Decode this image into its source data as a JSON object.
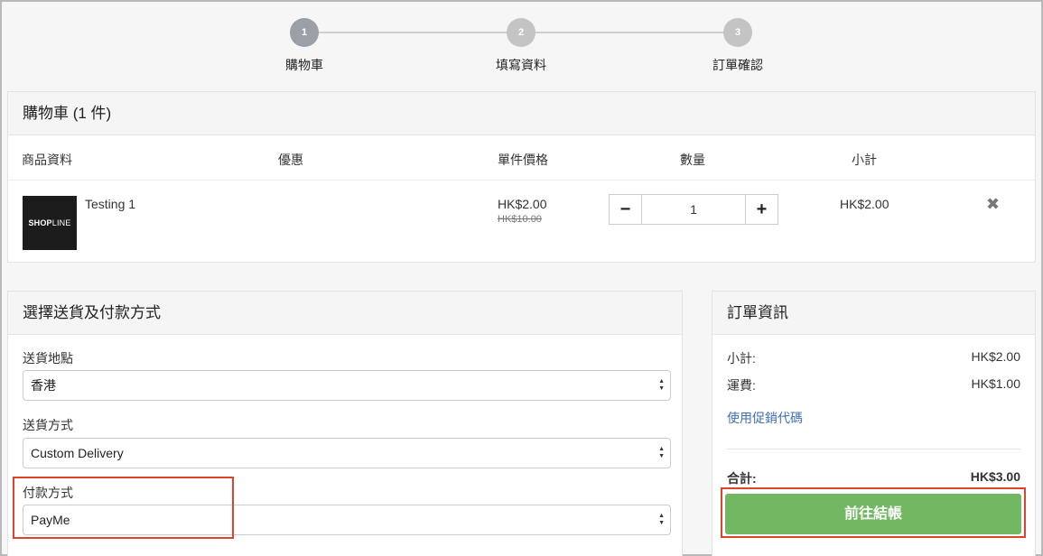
{
  "steps": [
    {
      "number": "1",
      "label": "購物車"
    },
    {
      "number": "2",
      "label": "填寫資料"
    },
    {
      "number": "3",
      "label": "訂單確認"
    }
  ],
  "cart": {
    "title": "購物車 (1 件)",
    "columns": {
      "product": "商品資料",
      "discount": "優惠",
      "unit_price": "單件價格",
      "quantity": "數量",
      "subtotal": "小計"
    },
    "items": [
      {
        "thumb_brand": "SHOP",
        "thumb_brand_suffix": "LINE",
        "name": "Testing 1",
        "price": "HK$2.00",
        "original_price": "HK$10.00",
        "quantity": "1",
        "subtotal": "HK$2.00"
      }
    ],
    "minus_label": "−",
    "plus_label": "+",
    "remove_label": "✖"
  },
  "delivery": {
    "title": "選擇送貨及付款方式",
    "location_label": "送貨地點",
    "location_value": "香港",
    "method_label": "送貨方式",
    "method_value": "Custom Delivery",
    "payment_label": "付款方式",
    "payment_value": "PayMe"
  },
  "summary": {
    "title": "訂單資訊",
    "subtotal_label": "小計:",
    "subtotal_value": "HK$2.00",
    "shipping_label": "運費:",
    "shipping_value": "HK$1.00",
    "promo_link": "使用促銷代碼",
    "total_label": "合計:",
    "total_value": "HK$3.00",
    "checkout_label": "前往結帳"
  },
  "colors": {
    "accent_green": "#72b862",
    "highlight_red": "#e0432b",
    "link_blue": "#3e6fb2"
  }
}
